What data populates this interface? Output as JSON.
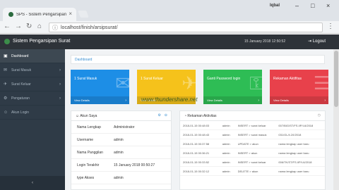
{
  "browser": {
    "tab_title": "SPS - Sistem Pengarsipan",
    "profile": "Iqbal",
    "url_host": "localhost",
    "url_path": "/finish/arsipsurat/"
  },
  "header": {
    "brand": "Sistem Pengarsipan Surat",
    "datetime": "15 January 2018  12:50:52",
    "logout": "Logout"
  },
  "sidebar": {
    "items": [
      {
        "label": "Dashboard",
        "icon": "dashboard-icon"
      },
      {
        "label": "Surat Masuk",
        "icon": "inbox-icon"
      },
      {
        "label": "Surat Keluar",
        "icon": "outbox-icon"
      },
      {
        "label": "Pengaturan",
        "icon": "gear-icon"
      },
      {
        "label": "Akun Login",
        "icon": "user-icon"
      }
    ]
  },
  "main": {
    "breadcrumb": "Dashboard",
    "cards": [
      {
        "title": "1 Surat Masuk",
        "details": "View Details",
        "color": "#1d8ee6"
      },
      {
        "title": "1 Surat Keluar",
        "details": "View Details",
        "color": "#f5c21b"
      },
      {
        "title": "Ganti Password login",
        "details": "View Details",
        "color": "#2ebd55"
      },
      {
        "title": "Rekaman Aktifitas",
        "details": "View Details",
        "color": "#e8414b"
      }
    ],
    "account": {
      "title": "Akun Saya",
      "rows": [
        {
          "k": "Nama Lengkap",
          "v": "Administrator"
        },
        {
          "k": "Username",
          "v": "admin"
        },
        {
          "k": "Nama Panggilan",
          "v": "admin"
        },
        {
          "k": "Login Terakhir",
          "v": "15 January 2018 00:50:27"
        },
        {
          "k": "type Akses",
          "v": "admin"
        }
      ]
    },
    "activity": {
      "title": "Rekaman Aktivitas",
      "rows": [
        {
          "t": "2018-01-15 00:48:03",
          "u": "admin",
          "a": "INSERT > surat keluar",
          "d": "007/BIG/ST/FS.IIP/I-6/2018"
        },
        {
          "t": "2018-01-15 00:48:43",
          "u": "admin",
          "a": "INSERT > surat masuk",
          "d": "031/GL/4.2/I/2018"
        },
        {
          "t": "2018-01-15 00:37:58",
          "u": "admin",
          "a": "UPDATE > akun",
          "d": "nama lengkap user baru"
        },
        {
          "t": "2018-01-15 00:36:21",
          "u": "admin",
          "a": "INSERT > akun",
          "d": "nama lengkap user baru"
        },
        {
          "t": "2018-01-15 00:33:52",
          "u": "admin",
          "a": "INSERT > surat keluar",
          "d": "006/TK/ST/FS.IIP/I-6/2018"
        },
        {
          "t": "2018-01-15 00:32:12",
          "u": "admin",
          "a": "DELETE > akun",
          "d": "nama lengkap user baru"
        }
      ]
    }
  },
  "watermark": "www.thundershare.net"
}
